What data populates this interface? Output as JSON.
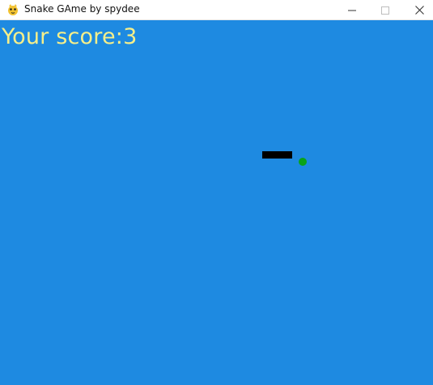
{
  "window": {
    "title": "Snake GAme by spydee",
    "icon": "pygame-snake-icon",
    "controls": [
      "minimize-icon",
      "maximize-icon",
      "close-icon"
    ]
  },
  "game": {
    "score_label": "Your score:",
    "score_value": "3",
    "colors": {
      "background": "#1e8ae1",
      "score_text": "#f6ef8a",
      "snake": "#000000",
      "food": "#0aa319"
    }
  }
}
